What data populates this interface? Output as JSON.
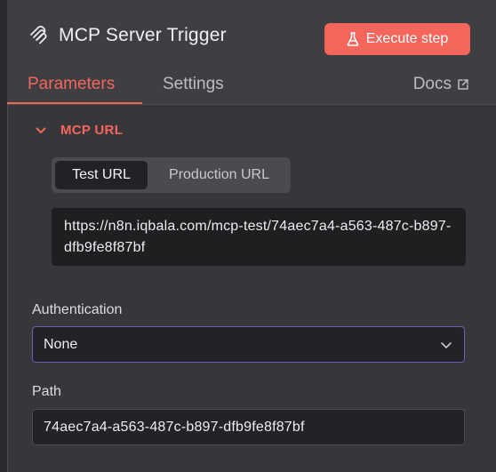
{
  "header": {
    "title": "MCP Server Trigger",
    "title_icon": "mcp-icon",
    "execute_label": "Execute step",
    "execute_icon": "flask-icon"
  },
  "tabs": [
    {
      "label": "Parameters",
      "active": true
    },
    {
      "label": "Settings",
      "active": false
    }
  ],
  "docs": {
    "label": "Docs",
    "icon": "external-link-icon"
  },
  "mcp_url": {
    "section_title": "MCP URL",
    "toggle_options": [
      {
        "label": "Test URL",
        "active": true
      },
      {
        "label": "Production URL",
        "active": false
      }
    ],
    "url": "https://n8n.iqbala.com/mcp-test/74aec7a4-a563-487c-b897-dfb9fe8f87bf"
  },
  "authentication": {
    "label": "Authentication",
    "value": "None"
  },
  "path": {
    "label": "Path",
    "value": "74aec7a4-a563-487c-b897-dfb9fe8f87bf"
  },
  "colors": {
    "accent": "#f4665b",
    "panel": "#3a3a3e",
    "input_bg": "#232327",
    "focus_border": "#6a5fb0"
  }
}
